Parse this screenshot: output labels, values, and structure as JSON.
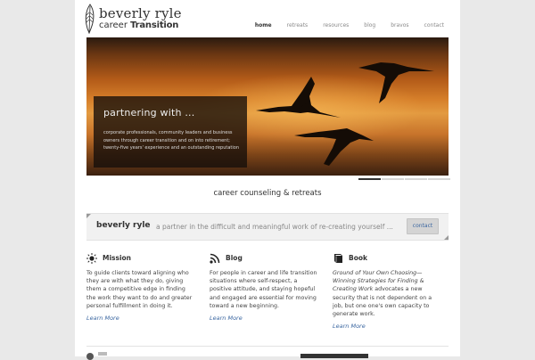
{
  "brand": {
    "name": "beverly ryle",
    "sub_regular": "career",
    "sub_bold": "Transition"
  },
  "nav": {
    "items": [
      "home",
      "retreats",
      "resources",
      "blog",
      "bravos",
      "contact"
    ],
    "active": "home"
  },
  "hero": {
    "heading": "partnering with ...",
    "body": "corporate professionals, community leaders and business owners through career transition and on into retirement; twenty-five years' experience and an outstanding reputation",
    "slides_total": 4,
    "slide_active": 1
  },
  "tagline": "career counseling & retreats",
  "callout": {
    "name": "beverly ryle",
    "message": "a partner in the difficult and meaningful work of re-creating yourself ...",
    "button": "contact"
  },
  "columns": [
    {
      "icon": "sun-icon",
      "title": "Mission",
      "text": "To guide clients toward aligning who they are with what they do, giving them a competitive edge in finding the work they want to do and greater personal fulfillment in doing it.",
      "link": "Learn More"
    },
    {
      "icon": "rss-icon",
      "title": "Blog",
      "text": "For people in career and life transition situations where self-respect, a positive attitude, and staying hopeful and engaged are essential for moving toward a new beginning.",
      "link": "Learn More"
    },
    {
      "icon": "book-icon",
      "title": "Book",
      "text_italic": "Ground of Your Own Choosing—Winning Strategies for Finding & Creating Work",
      "text": " advocates a new security that is not dependent on a job, but one one's own capacity to generate work.",
      "link": "Learn More"
    }
  ],
  "colors": {
    "link": "#3a66a0",
    "page_bg": "#e9e9e9",
    "panel": "#f1f1f1"
  }
}
